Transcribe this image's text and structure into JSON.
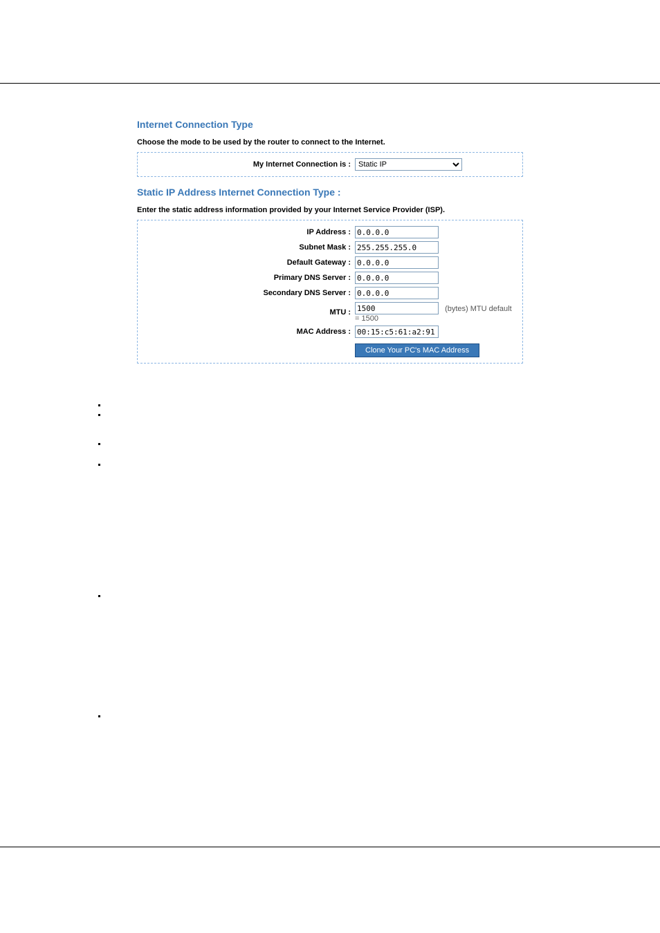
{
  "section1": {
    "title": "Internet Connection Type",
    "prompt": "Choose the mode to be used by the router to connect to the Internet.",
    "select_label": "My Internet Connection is :",
    "select_value": "Static IP"
  },
  "section2": {
    "title": "Static IP Address Internet Connection Type :",
    "prompt": "Enter the static address information provided by your Internet Service Provider (ISP).",
    "fields": {
      "ip_label": "IP Address :",
      "ip_value": "0.0.0.0",
      "subnet_label": "Subnet Mask :",
      "subnet_value": "255.255.255.0",
      "gateway_label": "Default Gateway :",
      "gateway_value": "0.0.0.0",
      "dns1_label": "Primary DNS Server :",
      "dns1_value": "0.0.0.0",
      "dns2_label": "Secondary DNS Server :",
      "dns2_value": "0.0.0.0",
      "mtu_label": "MTU :",
      "mtu_value": "1500",
      "mtu_after": "(bytes) MTU default = 1500",
      "mac_label": "MAC Address :",
      "mac_value": "00:15:c5:61:a2:91"
    },
    "clone_button": "Clone Your PC's MAC Address"
  }
}
